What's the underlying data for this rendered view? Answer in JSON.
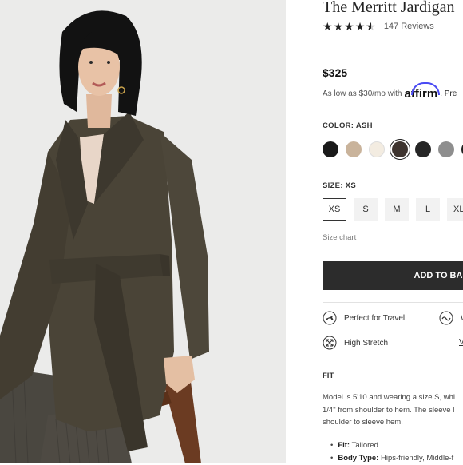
{
  "product": {
    "title": "The Merritt Jardigan",
    "rating": 4.5,
    "reviews": "147 Reviews",
    "price": "$325",
    "affirm_prefix": "As low as $30/mo with",
    "affirm_brand": "affirm",
    "affirm_link": ". Pre"
  },
  "color": {
    "label": "COLOR: ASH",
    "swatches": [
      {
        "name": "black",
        "hex": "#1a1a1a"
      },
      {
        "name": "camel",
        "hex": "#c9b39b"
      },
      {
        "name": "ivory",
        "hex": "#f3ece1"
      },
      {
        "name": "ash",
        "hex": "#3e342f",
        "selected": true
      },
      {
        "name": "charcoal",
        "hex": "#262626"
      },
      {
        "name": "grey",
        "hex": "#8e8e8e"
      },
      {
        "name": "dark",
        "hex": "#202020"
      }
    ]
  },
  "size": {
    "label": "SIZE: XS",
    "options": [
      "XS",
      "S",
      "M",
      "L",
      "XL"
    ],
    "selected": "XS",
    "chart_link": "Size chart"
  },
  "cta": {
    "add_to_bag": "ADD TO BAG"
  },
  "features": {
    "travel": "Perfect for Travel",
    "stretch": "High Stretch",
    "col2_a": "W",
    "col2_b": "V"
  },
  "fit": {
    "heading": "FIT",
    "lines": [
      "Model is 5'10 and wearing a size S, whi",
      "1/4\" from shoulder to hem. The sleeve l",
      "shoulder to sleeve hem."
    ],
    "bullets": [
      {
        "key": "Fit:",
        "value": "Tailored"
      },
      {
        "key": "Body Type:",
        "value": "Hips-friendly, Middle-f"
      }
    ]
  }
}
